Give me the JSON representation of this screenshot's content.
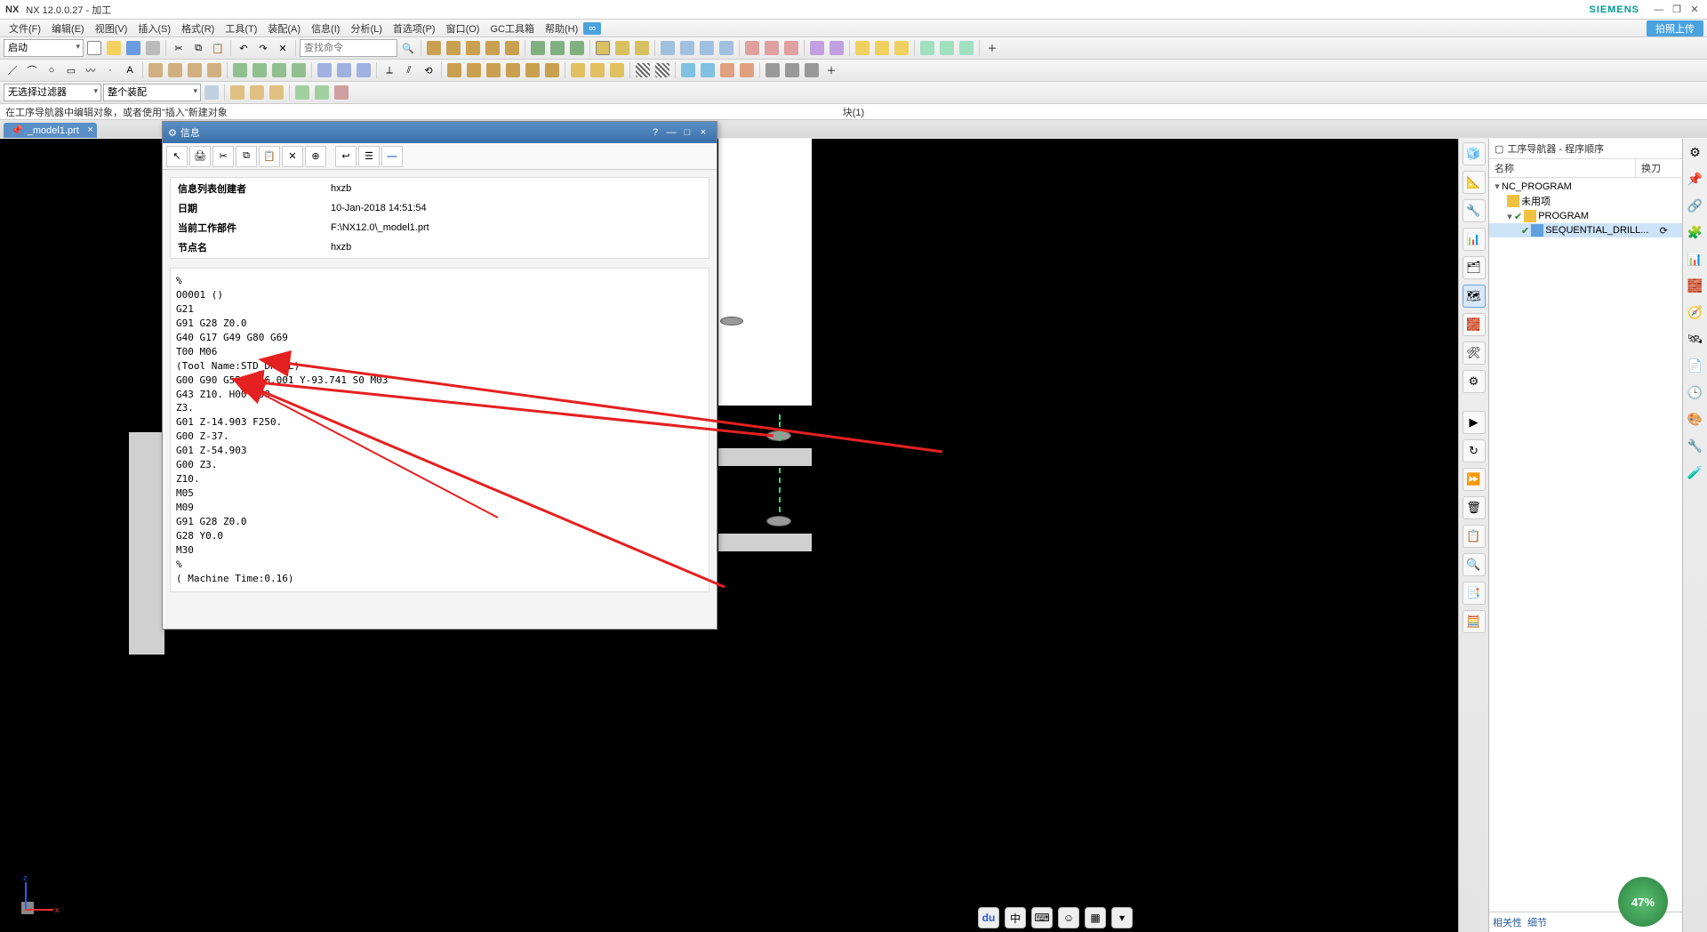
{
  "titlebar": {
    "app": "NX",
    "version": "NX 12.0.0.27 - 加工",
    "brand": "SIEMENS"
  },
  "menus": [
    "文件(F)",
    "编辑(E)",
    "视图(V)",
    "插入(S)",
    "格式(R)",
    "工具(T)",
    "装配(A)",
    "信息(I)",
    "分析(L)",
    "首选项(P)",
    "窗口(O)",
    "GC工具箱",
    "帮助(H)"
  ],
  "upload_btn": "拍照上传",
  "toolbar1": {
    "start_label": "启动"
  },
  "search_placeholder": "查找命令",
  "filter1": "无选择过滤器",
  "filter2": "整个装配",
  "msgbar": {
    "left": "在工序导航器中编辑对象，或者使用\"插入\"新建对象",
    "center": "块(1)"
  },
  "tab": {
    "label": "_model1.prt",
    "pin": "📌",
    "close": "×"
  },
  "dialog": {
    "title": "信息",
    "help": "?",
    "min": "—",
    "max": "□",
    "close": "×",
    "info_rows": [
      {
        "k": "信息列表创建者",
        "v": "hxzb"
      },
      {
        "k": "日期",
        "v": "10-Jan-2018 14:51:54"
      },
      {
        "k": "当前工作部件",
        "v": "F:\\NX12.0\\_model1.prt"
      },
      {
        "k": "节点名",
        "v": "hxzb"
      }
    ],
    "code": "%\nO0001 ()\nG21\nG91 G28 Z0.0\nG40 G17 G49 G80 G69\nT00 M06\n(Tool Name:STD_DRILL)\nG00 G90 G55 X136.001 Y-93.741 S0 M03\nG43 Z10. H00 M08\nZ3.\nG01 Z-14.903 F250.\nG00 Z-37.\nG01 Z-54.903\nG00 Z3.\nZ10.\nM05\nM09\nG91 G28 Z0.0\nG28 Y0.0\nM30\n%\n( Machine Time:0.16)"
  },
  "nav": {
    "title": "工序导航器 - 程序顺序",
    "col1": "名称",
    "col2": "换刀",
    "tree": {
      "root": "NC_PROGRAM",
      "unused": "未用项",
      "program": "PROGRAM",
      "seq": "SEQUENTIAL_DRILL..."
    },
    "footer": [
      "相关性",
      "细节"
    ]
  },
  "progress": "47%",
  "colors": {
    "accent": "#5a8fc7",
    "sel": "#cde3f8",
    "red": "#e52020"
  }
}
